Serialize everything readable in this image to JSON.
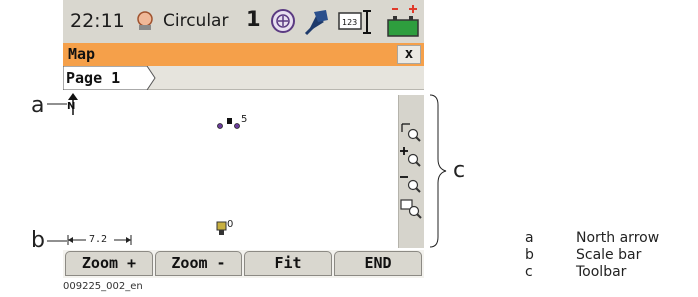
{
  "status_bar": {
    "time": "22:11",
    "mode": "Circular",
    "indicator_number": "1",
    "icons": [
      "target-icon",
      "prism-icon",
      "keypad-123-icon",
      "battery-icon"
    ]
  },
  "window": {
    "title": "Map",
    "close_label": "x"
  },
  "tabs": [
    {
      "label": "Page 1"
    }
  ],
  "map": {
    "north_label": "N",
    "scale_bar_text": "|← 7.2 →|",
    "points": [
      {
        "label": "5"
      },
      {
        "label": "0"
      }
    ]
  },
  "toolbar": {
    "icons": [
      "zoom-extent-icon",
      "zoom-in-icon",
      "zoom-out-icon",
      "zoom-window-icon"
    ]
  },
  "softkeys": [
    "Zoom +",
    "Zoom -",
    "Fit",
    "END"
  ],
  "callouts": {
    "a": "a",
    "b": "b",
    "c": "c"
  },
  "legend": [
    {
      "key": "a",
      "value": "North arrow"
    },
    {
      "key": "b",
      "value": "Scale bar"
    },
    {
      "key": "c",
      "value": "Toolbar"
    }
  ],
  "image_caption": "009225_002_en",
  "colors": {
    "title_bar": "#f5a04a",
    "status_bar": "#d9d7cf",
    "battery": "#2e9e3e",
    "battery_alert": "#e03a2a"
  }
}
